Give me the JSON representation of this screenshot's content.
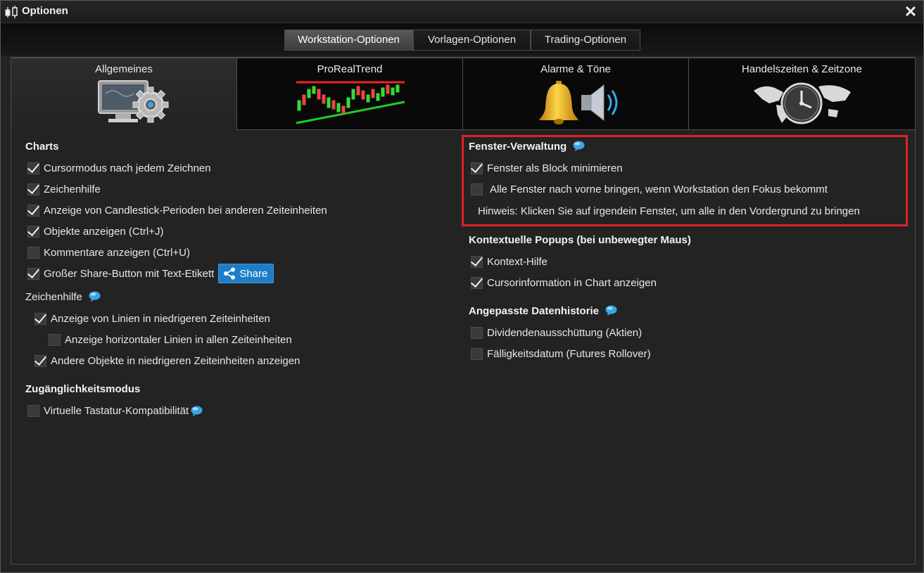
{
  "window": {
    "title": "Optionen",
    "title_icon": "candlestick-icon",
    "close_icon": "close-icon"
  },
  "top_tabs": [
    {
      "label": "Workstation-Optionen",
      "active": true
    },
    {
      "label": "Vorlagen-Optionen",
      "active": false
    },
    {
      "label": "Trading-Optionen",
      "active": false
    }
  ],
  "big_tabs": [
    {
      "label": "Allgemeines",
      "icon": "computer-gear-icon",
      "active": true
    },
    {
      "label": "ProRealTrend",
      "icon": "trend-chart-icon",
      "active": false
    },
    {
      "label": "Alarme & Töne",
      "icon": "bell-speaker-icon",
      "active": false
    },
    {
      "label": "Handelszeiten & Zeitzone",
      "icon": "world-clock-icon",
      "active": false
    }
  ],
  "left": {
    "charts_title": "Charts",
    "charts_items": [
      {
        "label": "Cursormodus nach jedem Zeichnen",
        "checked": true
      },
      {
        "label": "Zeichenhilfe",
        "checked": true
      },
      {
        "label": "Anzeige von Candlestick-Perioden bei anderen Zeiteinheiten",
        "checked": true
      },
      {
        "label": "Objekte anzeigen (Ctrl+J)",
        "checked": true
      },
      {
        "label": "Kommentare anzeigen (Ctrl+U)",
        "checked": false
      },
      {
        "label": "Großer Share-Button mit Text-Etikett",
        "checked": true
      }
    ],
    "share_button": "Share",
    "zeichenhilfe_title": "Zeichenhilfe",
    "zeichenhilfe_items": [
      {
        "label": "Anzeige von Linien in niedrigeren Zeiteinheiten",
        "checked": true
      },
      {
        "label": "Anzeige horizontaler Linien in allen Zeiteinheiten",
        "checked": false
      },
      {
        "label": "Andere Objekte in niedrigeren Zeiteinheiten anzeigen",
        "checked": true
      }
    ],
    "access_title": "Zugänglichkeitsmodus",
    "access_items": [
      {
        "label": "Virtuelle Tastatur-Kompatibilität",
        "checked": false
      }
    ]
  },
  "right": {
    "fenster_title": "Fenster-Verwaltung",
    "fenster_items": [
      {
        "label": "Fenster als Block minimieren",
        "checked": true
      },
      {
        "label": "Alle Fenster nach vorne bringen, wenn Workstation den Fokus bekommt",
        "checked": false
      }
    ],
    "fenster_hint": "Hinweis: Klicken Sie auf irgendein Fenster, um alle in den Vordergrund zu bringen",
    "popup_title": "Kontextuelle Popups (bei unbewegter Maus)",
    "popup_items": [
      {
        "label": "Kontext-Hilfe",
        "checked": true
      },
      {
        "label": "Cursorinformation in Chart anzeigen",
        "checked": true
      }
    ],
    "daten_title": "Angepasste Datenhistorie",
    "daten_items": [
      {
        "label": "Dividendenausschüttung (Aktien)",
        "checked": false
      },
      {
        "label": "Fälligkeitsdatum (Futures Rollover)",
        "checked": false
      }
    ]
  },
  "colors": {
    "highlight": "#e0202a",
    "share_button": "#1d7dc8",
    "info_bubble": "#3aa6e8"
  }
}
